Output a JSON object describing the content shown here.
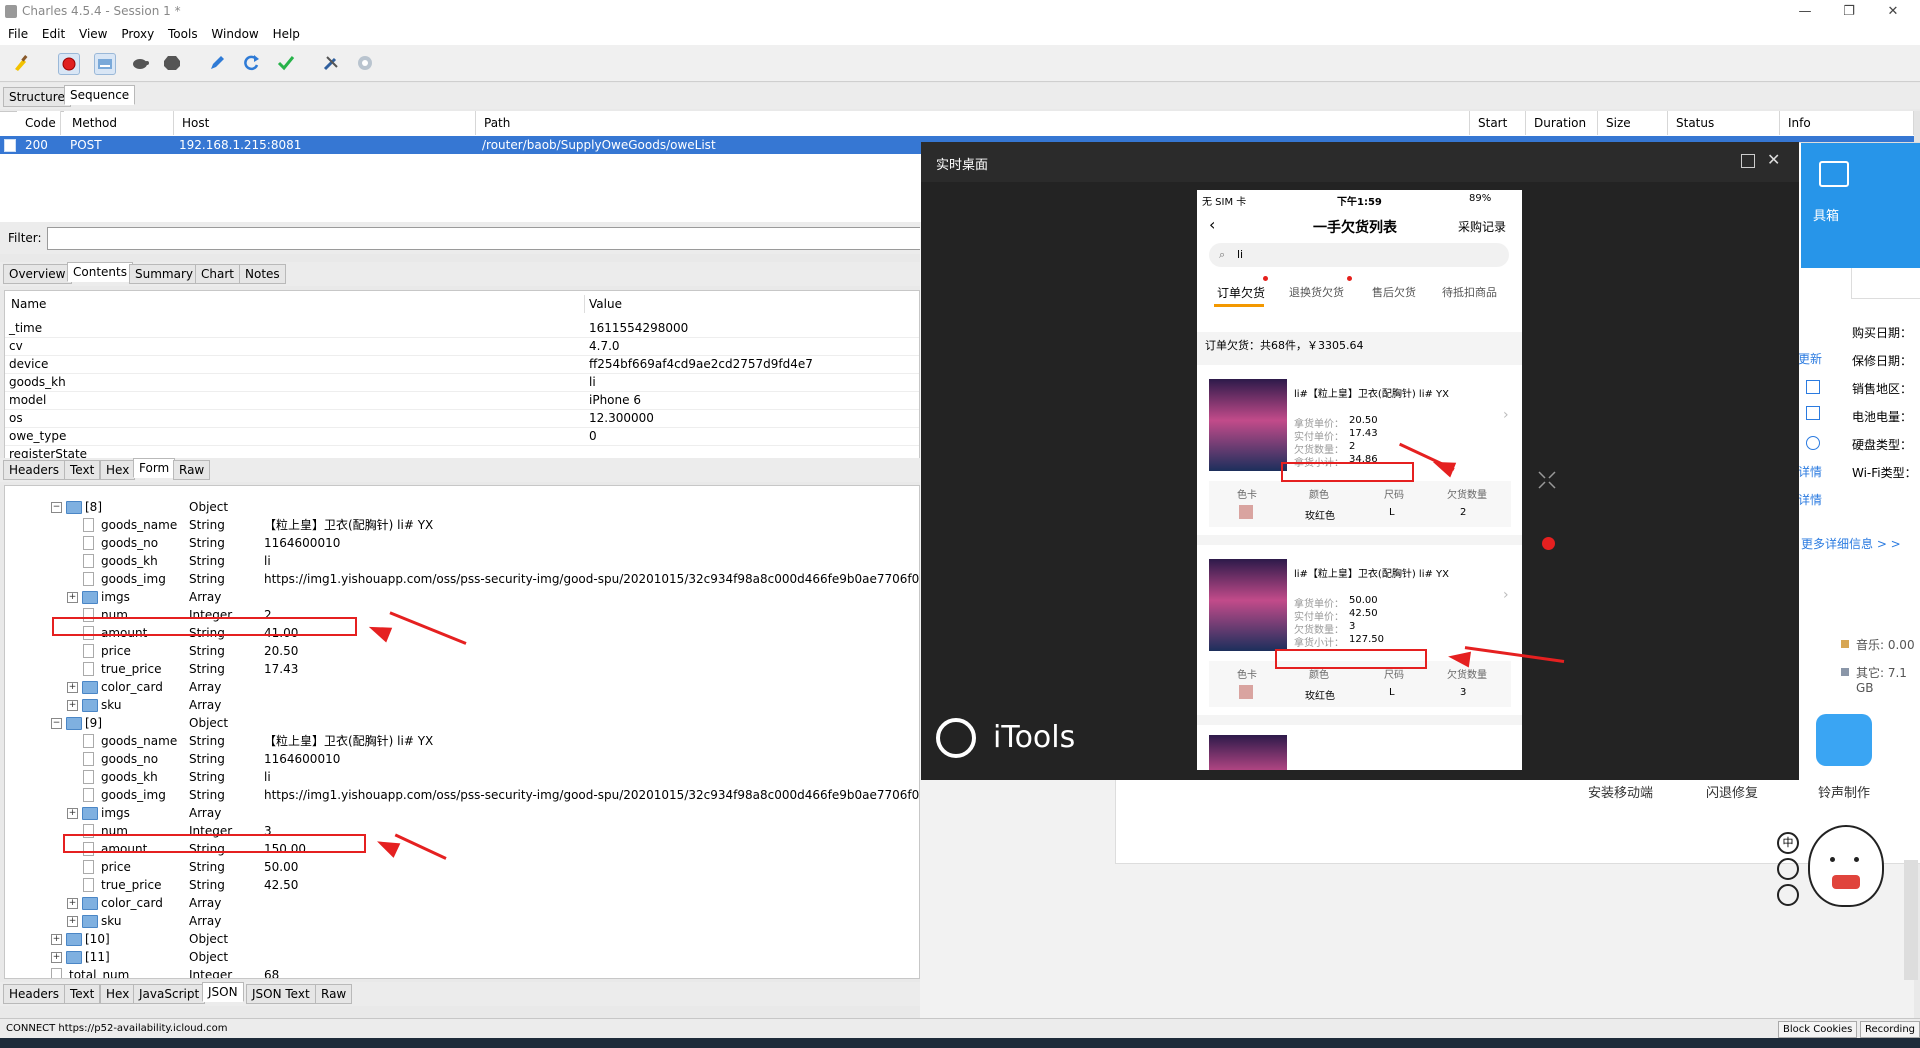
{
  "window": {
    "title": "Charles 4.5.4 - Session 1 *",
    "min": "—",
    "max": "❐",
    "close": "✕"
  },
  "menu": [
    "File",
    "Edit",
    "View",
    "Proxy",
    "Tools",
    "Window",
    "Help"
  ],
  "toolbar": [
    "broom-icon",
    "record-icon",
    "throttle-icon",
    "turtle-icon",
    "stop-icon",
    "pen-icon",
    "refresh-icon",
    "check-icon",
    "tools-icon",
    "settings-icon"
  ],
  "view_tabs": [
    "Structure",
    "Sequence"
  ],
  "columns": [
    "Code",
    "Method",
    "Host",
    "Path",
    "Start",
    "Duration",
    "Size",
    "Status",
    "Info"
  ],
  "selected_row": {
    "code": "200",
    "method": "POST",
    "host": "192.168.1.215:8081",
    "path": "/router/baob/SupplyOweGoods/oweList"
  },
  "filter_label": "Filter:",
  "detail_tabs": [
    "Overview",
    "Contents",
    "Summary",
    "Chart",
    "Notes"
  ],
  "form_header": {
    "name": "Name",
    "value": "Value"
  },
  "form_rows": [
    {
      "name": "_time",
      "value": "1611554298000"
    },
    {
      "name": "cv",
      "value": "4.7.0"
    },
    {
      "name": "device",
      "value": "ff254bf669af4cd9ae2cd2757d9fd4e7"
    },
    {
      "name": "goods_kh",
      "value": "li"
    },
    {
      "name": "model",
      "value": "iPhone 6"
    },
    {
      "name": "os",
      "value": "12.300000"
    },
    {
      "name": "owe_type",
      "value": "0"
    },
    {
      "name": "registerState",
      "value": ""
    }
  ],
  "request_subtabs": [
    "Headers",
    "Text",
    "Hex",
    "Form",
    "Raw"
  ],
  "tree_rows": [
    {
      "indent": 3,
      "kind": "folder",
      "exp": "−",
      "name": "[8]",
      "type": "Object",
      "value": ""
    },
    {
      "indent": 4,
      "kind": "doc",
      "name": "goods_name",
      "type": "String",
      "value": "【粒上皇】卫衣(配胸针)  li#  YX"
    },
    {
      "indent": 4,
      "kind": "doc",
      "name": "goods_no",
      "type": "String",
      "value": "1164600010"
    },
    {
      "indent": 4,
      "kind": "doc",
      "name": "goods_kh",
      "type": "String",
      "value": "li"
    },
    {
      "indent": 4,
      "kind": "doc",
      "name": "goods_img",
      "type": "String",
      "value": "https://img1.yishouapp.com/oss/pss-security-img/good-spu/20201015/32c934f98a8c000d466fe9b0ae7706f0.jpg?x-oss-process=image/resize,w_750"
    },
    {
      "indent": 4,
      "kind": "folder",
      "exp": "+",
      "name": "imgs",
      "type": "Array",
      "value": ""
    },
    {
      "indent": 4,
      "kind": "doc",
      "name": "num",
      "type": "Integer",
      "value": "2"
    },
    {
      "indent": 4,
      "kind": "doc",
      "name": "amount",
      "type": "String",
      "value": "41.00"
    },
    {
      "indent": 4,
      "kind": "doc",
      "name": "price",
      "type": "String",
      "value": "20.50"
    },
    {
      "indent": 4,
      "kind": "doc",
      "name": "true_price",
      "type": "String",
      "value": "17.43"
    },
    {
      "indent": 4,
      "kind": "folder",
      "exp": "+",
      "name": "color_card",
      "type": "Array",
      "value": ""
    },
    {
      "indent": 4,
      "kind": "folder",
      "exp": "+",
      "name": "sku",
      "type": "Array",
      "value": ""
    },
    {
      "indent": 3,
      "kind": "folder",
      "exp": "−",
      "name": "[9]",
      "type": "Object",
      "value": ""
    },
    {
      "indent": 4,
      "kind": "doc",
      "name": "goods_name",
      "type": "String",
      "value": "【粒上皇】卫衣(配胸针)  li#  YX"
    },
    {
      "indent": 4,
      "kind": "doc",
      "name": "goods_no",
      "type": "String",
      "value": "1164600010"
    },
    {
      "indent": 4,
      "kind": "doc",
      "name": "goods_kh",
      "type": "String",
      "value": "li"
    },
    {
      "indent": 4,
      "kind": "doc",
      "name": "goods_img",
      "type": "String",
      "value": "https://img1.yishouapp.com/oss/pss-security-img/good-spu/20201015/32c934f98a8c000d466fe9b0ae7706f0.jpg?x-oss-process=image/resize,w_750"
    },
    {
      "indent": 4,
      "kind": "folder",
      "exp": "+",
      "name": "imgs",
      "type": "Array",
      "value": ""
    },
    {
      "indent": 4,
      "kind": "doc",
      "name": "num",
      "type": "Integer",
      "value": "3"
    },
    {
      "indent": 4,
      "kind": "doc",
      "name": "amount",
      "type": "String",
      "value": "150.00"
    },
    {
      "indent": 4,
      "kind": "doc",
      "name": "price",
      "type": "String",
      "value": "50.00"
    },
    {
      "indent": 4,
      "kind": "doc",
      "name": "true_price",
      "type": "String",
      "value": "42.50"
    },
    {
      "indent": 4,
      "kind": "folder",
      "exp": "+",
      "name": "color_card",
      "type": "Array",
      "value": ""
    },
    {
      "indent": 4,
      "kind": "folder",
      "exp": "+",
      "name": "sku",
      "type": "Array",
      "value": ""
    },
    {
      "indent": 3,
      "kind": "folder",
      "exp": "+",
      "name": "[10]",
      "type": "Object",
      "value": ""
    },
    {
      "indent": 3,
      "kind": "folder",
      "exp": "+",
      "name": "[11]",
      "type": "Object",
      "value": ""
    },
    {
      "indent": 2,
      "kind": "doc",
      "name": "total_num",
      "type": "Integer",
      "value": "68"
    }
  ],
  "response_subtabs": [
    "Headers",
    "Text",
    "Hex",
    "JavaScript",
    "JSON",
    "JSON Text",
    "Raw"
  ],
  "status": {
    "text": "CONNECT https://p52-availability.icloud.com",
    "block_cookies": "Block Cookies",
    "recording": "Recording"
  },
  "popup": {
    "title": "实时桌面",
    "logo": "iTools",
    "phone": {
      "carrier": "无 SIM 卡",
      "time": "下午1:59",
      "battery": "89%",
      "page_title": "一手欠货列表",
      "right_link": "采购记录",
      "search_value": "li",
      "tabs": [
        "订单欠货",
        "退换货欠货",
        "售后欠货",
        "待抵扣商品"
      ],
      "summary": "订单欠货：共68件，￥3305.64",
      "items": [
        {
          "name": "li#【粒上皇】卫衣(配胸针)  li#  YX",
          "price_label": "拿货单价：",
          "price": "20.50",
          "true_label": "实付单价：",
          "true_price": "17.43",
          "num_label": "欠货数量：",
          "num": "2",
          "subtotal_label": "拿货小计：",
          "subtotal": "34.86",
          "sku_headers": [
            "色卡",
            "颜色",
            "尺码",
            "欠货数量"
          ],
          "sku": {
            "color": "玫红色",
            "size": "L",
            "qty": "2"
          }
        },
        {
          "name": "li#【粒上皇】卫衣(配胸针)  li#  YX",
          "price_label": "拿货单价：",
          "price": "50.00",
          "true_label": "实付单价：",
          "true_price": "42.50",
          "num_label": "欠货数量：",
          "num": "3",
          "subtotal_label": "拿货小计：",
          "subtotal": "127.50",
          "sku_headers": [
            "色卡",
            "颜色",
            "尺码",
            "欠货数量"
          ],
          "sku": {
            "color": "玫红色",
            "size": "L",
            "qty": "3"
          }
        }
      ]
    }
  },
  "itools_right": {
    "toolbox": "具箱",
    "update": "更新",
    "details": "详情",
    "more_info": "更多详细信息 > >",
    "labels": [
      "购买日期：",
      "保修日期：",
      "销售地区：",
      "电池电量：",
      "硬盘类型：",
      "Wi-Fi类型："
    ],
    "music": "音乐: 0.00",
    "other": "其它: 7.1 GB",
    "bottom": [
      "安装移动端",
      "闪退修复",
      "铃声制作"
    ]
  },
  "colors": {
    "selection": "#3677d3",
    "annotation": "#e52020",
    "accent": "#f39800"
  }
}
